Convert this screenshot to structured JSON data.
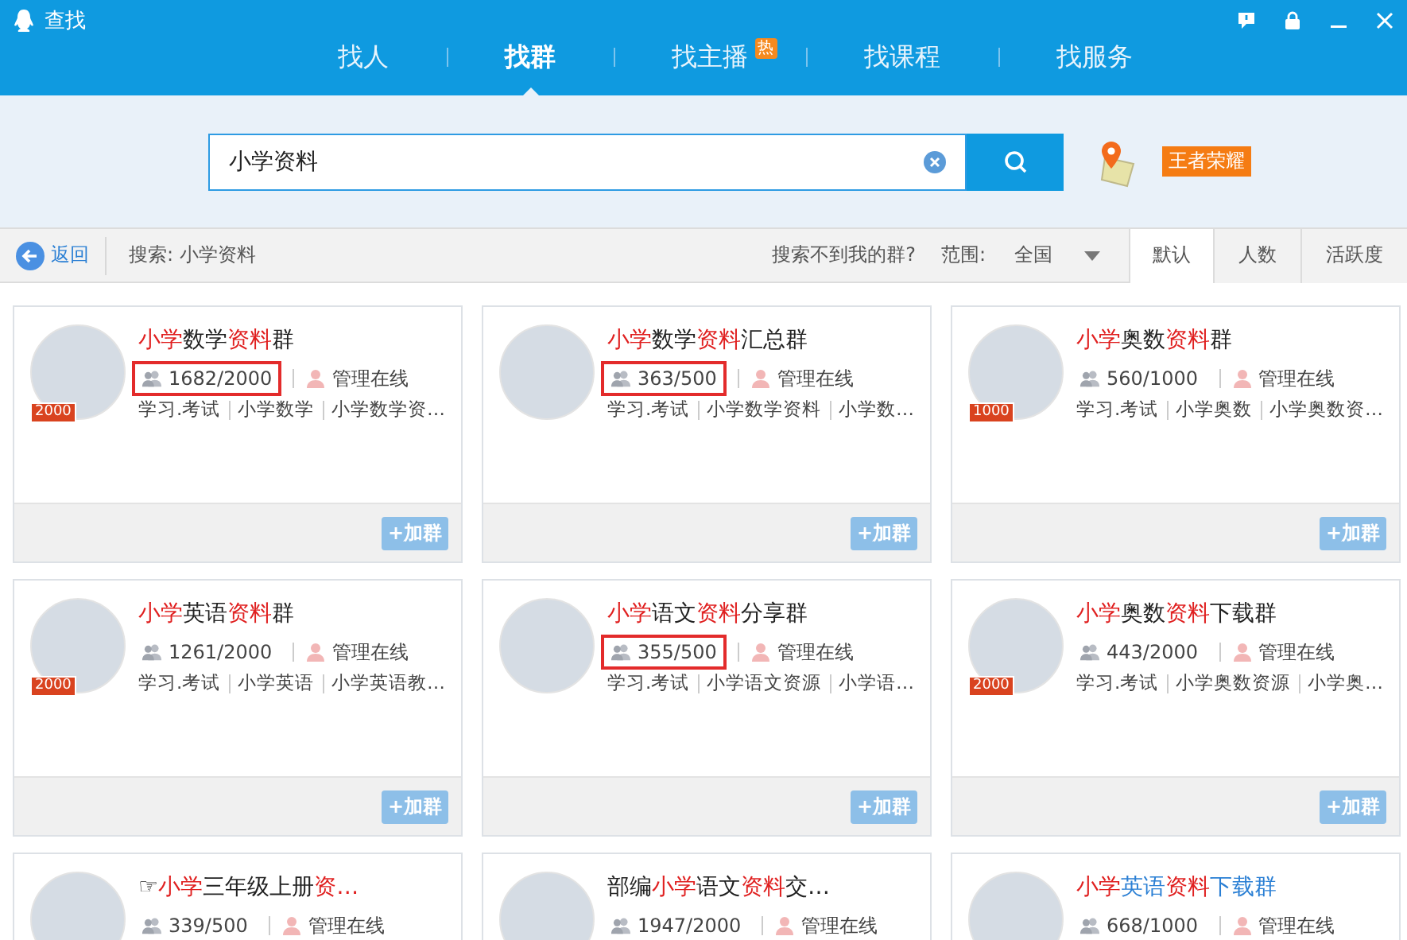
{
  "window": {
    "title": "查找"
  },
  "tabs": [
    {
      "label": "找人",
      "selected": false
    },
    {
      "label": "找群",
      "selected": true
    },
    {
      "label": "找主播",
      "selected": false,
      "badge": "热"
    },
    {
      "label": "找课程",
      "selected": false
    },
    {
      "label": "找服务",
      "selected": false
    }
  ],
  "search": {
    "value": "小学资料"
  },
  "promo_tag": "王者荣耀",
  "filter_bar": {
    "back": "返回",
    "query": "搜索: 小学资料",
    "help_link": "搜索不到我的群?",
    "scope_label": "范围:",
    "scope_value": "全国",
    "sort_tabs": [
      {
        "label": "默认",
        "selected": true
      },
      {
        "label": "人数",
        "selected": false
      },
      {
        "label": "活跃度",
        "selected": false
      }
    ]
  },
  "groups": [
    {
      "title": [
        {
          "text": "小学",
          "highlight": true
        },
        {
          "text": "数学",
          "highlight": false
        },
        {
          "text": "资料",
          "highlight": true
        },
        {
          "text": "群",
          "highlight": false
        }
      ],
      "featured": false,
      "avatar_badge": "2000",
      "members": "1682/2000",
      "annotated": true,
      "admin_status": "管理在线",
      "tags": [
        "学习.考试",
        "小学数学",
        "小学数学资…"
      ],
      "button": "+加群"
    },
    {
      "title": [
        {
          "text": "小学",
          "highlight": true
        },
        {
          "text": "数学",
          "highlight": false
        },
        {
          "text": "资料",
          "highlight": true
        },
        {
          "text": "汇总群",
          "highlight": false
        }
      ],
      "featured": false,
      "members": "363/500",
      "annotated": true,
      "admin_status": "管理在线",
      "tags": [
        "学习.考试",
        "小学数学资料",
        "小学数…"
      ],
      "button": "+加群"
    },
    {
      "title": [
        {
          "text": "小学",
          "highlight": true
        },
        {
          "text": "奥数",
          "highlight": false
        },
        {
          "text": "资料",
          "highlight": true
        },
        {
          "text": "群",
          "highlight": false
        }
      ],
      "featured": false,
      "avatar_badge": "1000",
      "members": "560/1000",
      "annotated": false,
      "admin_status": "管理在线",
      "tags": [
        "学习.考试",
        "小学奥数",
        "小学奥数资…"
      ],
      "button": "+加群"
    },
    {
      "title": [
        {
          "text": "小学",
          "highlight": true
        },
        {
          "text": "英语",
          "highlight": false
        },
        {
          "text": "资料",
          "highlight": true
        },
        {
          "text": "群",
          "highlight": false
        }
      ],
      "featured": false,
      "avatar_badge": "2000",
      "members": "1261/2000",
      "annotated": false,
      "admin_status": "管理在线",
      "tags": [
        "学习.考试",
        "小学英语",
        "小学英语教…"
      ],
      "button": "+加群"
    },
    {
      "title": [
        {
          "text": "小学",
          "highlight": true
        },
        {
          "text": "语文",
          "highlight": false
        },
        {
          "text": "资料",
          "highlight": true
        },
        {
          "text": "分享群",
          "highlight": false
        }
      ],
      "featured": false,
      "members": "355/500",
      "annotated": true,
      "admin_status": "管理在线",
      "tags": [
        "学习.考试",
        "小学语文资源",
        "小学语…"
      ],
      "button": "+加群"
    },
    {
      "title": [
        {
          "text": "小学",
          "highlight": true
        },
        {
          "text": "奥数",
          "highlight": false
        },
        {
          "text": "资料",
          "highlight": true
        },
        {
          "text": "下载群",
          "highlight": false
        }
      ],
      "featured": false,
      "avatar_badge": "2000",
      "members": "443/2000",
      "annotated": false,
      "admin_status": "管理在线",
      "tags": [
        "学习.考试",
        "小学奥数资源",
        "小学奥…"
      ],
      "button": "+加群"
    },
    {
      "title": [
        {
          "text": "☞",
          "highlight": false
        },
        {
          "text": "小学",
          "highlight": true
        },
        {
          "text": "三年级上册",
          "highlight": false
        },
        {
          "text": "资…",
          "highlight": true
        }
      ],
      "featured": false,
      "members": "339/500",
      "annotated": false,
      "admin_status": "管理在线"
    },
    {
      "title": [
        {
          "text": "部编",
          "highlight": false
        },
        {
          "text": "小学",
          "highlight": true
        },
        {
          "text": "语文",
          "highlight": false
        },
        {
          "text": "资料",
          "highlight": true
        },
        {
          "text": "交…",
          "highlight": false
        }
      ],
      "featured": false,
      "members": "1947/2000",
      "annotated": false,
      "admin_status": "管理在线"
    },
    {
      "title": [
        {
          "text": "小学",
          "highlight": true
        },
        {
          "text": "英语",
          "highlight": false
        },
        {
          "text": "资料",
          "highlight": true
        },
        {
          "text": "下载群",
          "highlight": false
        }
      ],
      "featured": true,
      "members": "668/1000",
      "annotated": false,
      "admin_status": "管理在线"
    }
  ]
}
